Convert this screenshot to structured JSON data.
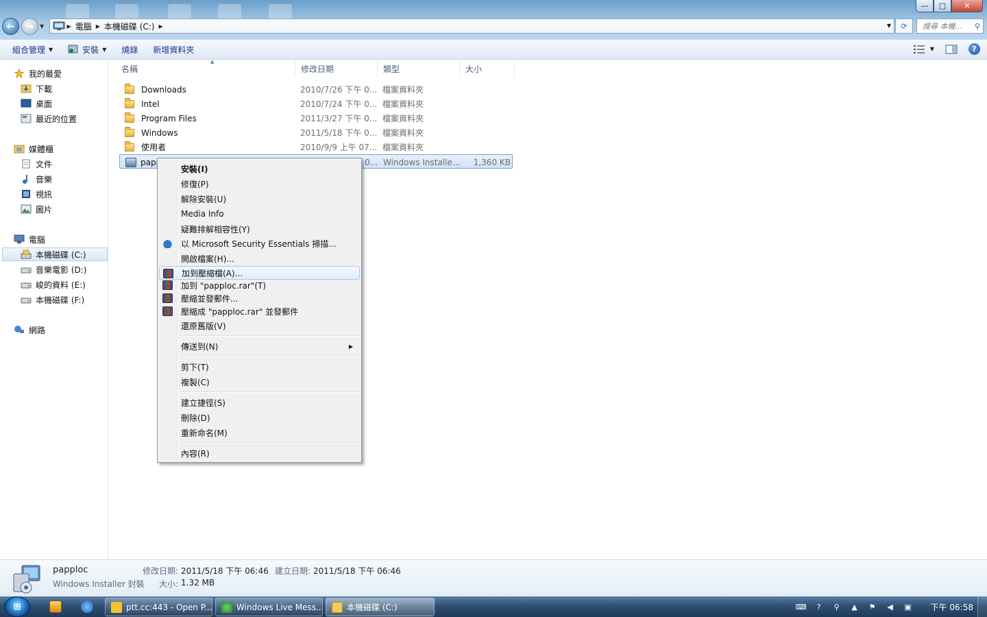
{
  "window": {
    "buttons": {
      "minimize": "—",
      "maximize": "□",
      "close": "✕"
    }
  },
  "address": {
    "crumbs": [
      "電腦",
      "本機磁碟 (C:)"
    ],
    "search_placeholder": "搜尋 本機..."
  },
  "toolbar": {
    "organize": "組合管理",
    "install": "安裝",
    "burn": "燒錄",
    "new_folder": "新增資料夾"
  },
  "nav": {
    "favorites": "我的最愛",
    "downloads": "下載",
    "desktop": "桌面",
    "recent": "最近的位置",
    "libraries": "媒體櫃",
    "documents": "文件",
    "music": "音樂",
    "videos": "視訊",
    "pictures": "圖片",
    "computer": "電腦",
    "drive_c": "本機磁碟 (C:)",
    "drive_d": "音樂電影 (D:)",
    "drive_e": "峻的資料 (E:)",
    "drive_f": "本機磁碟 (F:)",
    "network": "網路"
  },
  "columns": {
    "name": "名稱",
    "date": "修改日期",
    "type": "類型",
    "size": "大小"
  },
  "files": [
    {
      "name": "Downloads",
      "date": "2010/7/26 下午 0...",
      "type": "檔案資料夾",
      "size": ""
    },
    {
      "name": "Intel",
      "date": "2010/7/24 下午 0...",
      "type": "檔案資料夾",
      "size": ""
    },
    {
      "name": "Program Files",
      "date": "2011/3/27 下午 0...",
      "type": "檔案資料夾",
      "size": ""
    },
    {
      "name": "Windows",
      "date": "2011/5/18 下午 0...",
      "type": "檔案資料夾",
      "size": ""
    },
    {
      "name": "使用者",
      "date": "2010/9/9 上午 07...",
      "type": "檔案資料夾",
      "size": ""
    },
    {
      "name": "papp",
      "date": "2011/5/18 下午 0...",
      "type": "Windows Installe...",
      "size": "1,360 KB"
    }
  ],
  "context_menu": {
    "install": "安裝(I)",
    "repair": "修復(P)",
    "uninstall": "解除安裝(U)",
    "media_info": "Media Info",
    "troubleshoot": "疑難排解相容性(Y)",
    "mse_scan": "以 Microsoft Security Essentials 掃描...",
    "open_file": "開啟檔案(H)...",
    "add_archive": "加到壓縮檔(A)...",
    "add_rar": "加到 \"papploc.rar\"(T)",
    "compress_email": "壓縮並發郵件...",
    "compress_rar_email": "壓縮成 \"papploc.rar\" 並發郵件",
    "restore": "還原舊版(V)",
    "send_to": "傳送到(N)",
    "cut": "剪下(T)",
    "copy": "複製(C)",
    "shortcut": "建立捷徑(S)",
    "delete": "刪除(D)",
    "rename": "重新命名(M)",
    "properties": "內容(R)"
  },
  "details": {
    "name": "papploc",
    "kind": "Windows Installer 封裝",
    "modified_label": "修改日期:",
    "modified_value": "2011/5/18 下午 06:46",
    "created_label": "建立日期:",
    "created_value": "2011/5/18 下午 06:46",
    "size_label": "大小:",
    "size_value": "1.32 MB"
  },
  "taskbar": {
    "items": [
      "ptt.cc:443 - Open P...",
      "Windows Live Mess...",
      "本機磁碟 (C:)"
    ],
    "clock": "下午 06:58"
  },
  "colors": {
    "selection": "#cfe3f8",
    "menu_bg": "#f0f0f0",
    "taskbar": "#2f4f72",
    "link_text": "#1e3287"
  }
}
